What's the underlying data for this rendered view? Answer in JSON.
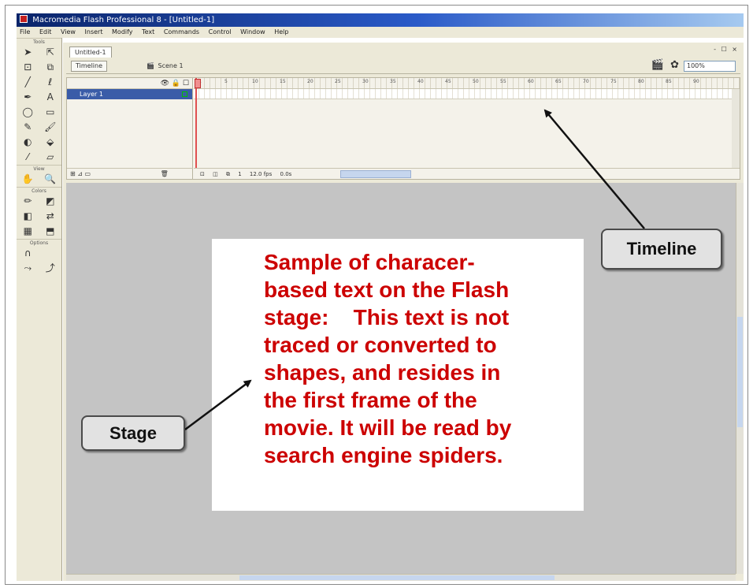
{
  "window": {
    "title": "Macromedia Flash Professional 8 - [Untitled-1]"
  },
  "menubar": {
    "items": [
      "File",
      "Edit",
      "View",
      "Insert",
      "Modify",
      "Text",
      "Commands",
      "Control",
      "Window",
      "Help"
    ]
  },
  "tools_panel": {
    "label_tools": "Tools",
    "label_view": "View",
    "label_colors": "Colors",
    "label_options": "Options"
  },
  "document": {
    "tab_label": "Untitled-1",
    "window_controls": "- ☐ ×"
  },
  "editbar": {
    "timeline_button": "Timeline",
    "scene_label": "Scene 1",
    "zoom_value": "100%"
  },
  "timeline": {
    "header_icons": "👁 🔒 ☐",
    "layer_name": "Layer 1",
    "frame_numbers": [
      "1",
      "5",
      "10",
      "15",
      "20",
      "25",
      "30",
      "35",
      "40",
      "45",
      "50",
      "55",
      "60",
      "65",
      "70",
      "75",
      "80",
      "85",
      "90"
    ],
    "current_frame": "1",
    "frame_rate": "12.0 fps",
    "elapsed_time": "0.0s"
  },
  "stage": {
    "text": "Sample of characer-\nbased text on the Flash\nstage:    This text is not\ntraced or converted to\nshapes, and resides in\nthe first frame of the\nmovie. It will be read by\nsearch engine spiders.",
    "text_color": "#cc0000"
  },
  "callouts": {
    "timeline_label": "Timeline",
    "stage_label": "Stage"
  },
  "colors": {
    "title_bar": "#0a246a",
    "panel": "#ece9d8",
    "work_area": "#c4c4c4",
    "layer_selected": "#3a5ca8"
  }
}
